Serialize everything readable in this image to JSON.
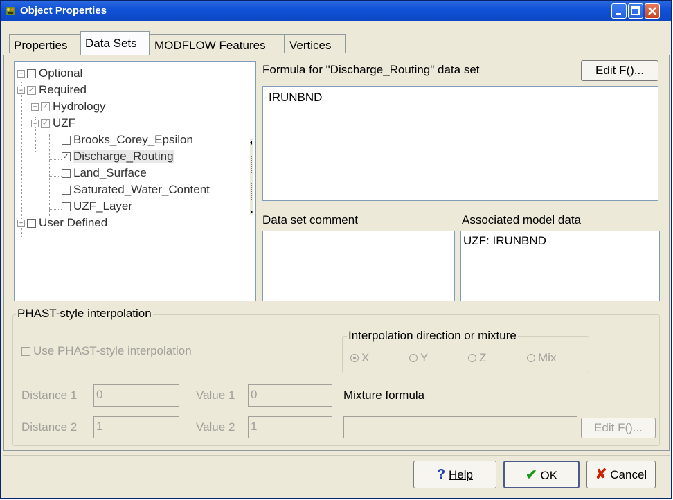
{
  "window": {
    "title": "Object Properties"
  },
  "tabs": [
    {
      "label": "Properties",
      "active": false
    },
    {
      "label": "Data Sets",
      "active": true
    },
    {
      "label": "MODFLOW Features",
      "active": false
    },
    {
      "label": "Vertices",
      "active": false
    }
  ],
  "tree": {
    "items": [
      {
        "label": "Optional",
        "expander": "+",
        "checked": false
      },
      {
        "label": "Required",
        "expander": "−",
        "checked": true
      },
      {
        "label": "Hydrology",
        "expander": "+",
        "checked": true
      },
      {
        "label": "UZF",
        "expander": "−",
        "checked": true
      },
      {
        "label": "Brooks_Corey_Epsilon",
        "checked": false
      },
      {
        "label": "Discharge_Routing",
        "checked": true,
        "selected": true
      },
      {
        "label": "Land_Surface",
        "checked": false
      },
      {
        "label": "Saturated_Water_Content",
        "checked": false
      },
      {
        "label": "UZF_Layer",
        "checked": false
      },
      {
        "label": "User Defined",
        "expander": "+",
        "checked": false
      }
    ]
  },
  "formula": {
    "heading": "Formula for \"Discharge_Routing\" data set",
    "edit_button": "Edit F()...",
    "value": "IRUNBND"
  },
  "comment": {
    "heading": "Data set comment",
    "value": ""
  },
  "associated": {
    "heading": "Associated model data",
    "value": "UZF: IRUNBND"
  },
  "phast": {
    "group_label": "PHAST-style interpolation",
    "use_checkbox": "Use PHAST-style interpolation",
    "direction_group": "Interpolation direction or mixture",
    "radios": [
      {
        "label": "X",
        "checked": true
      },
      {
        "label": "Y",
        "checked": false
      },
      {
        "label": "Z",
        "checked": false
      },
      {
        "label": "Mix",
        "checked": false
      }
    ],
    "distance1_label": "Distance 1",
    "distance1_value": "0",
    "value1_label": "Value 1",
    "value1_value": "0",
    "distance2_label": "Distance 2",
    "distance2_value": "1",
    "value2_label": "Value 2",
    "value2_value": "1",
    "mixture_label": "Mixture formula",
    "mixture_value": "",
    "mixture_edit_button": "Edit F()..."
  },
  "buttons": {
    "help": "Help",
    "ok": "OK",
    "cancel": "Cancel"
  },
  "colors": {
    "title_bar": "#0c46c2",
    "ok_check": "#1a9a1a",
    "cancel_x": "#cc2200",
    "help_q": "#1f3fb0"
  }
}
